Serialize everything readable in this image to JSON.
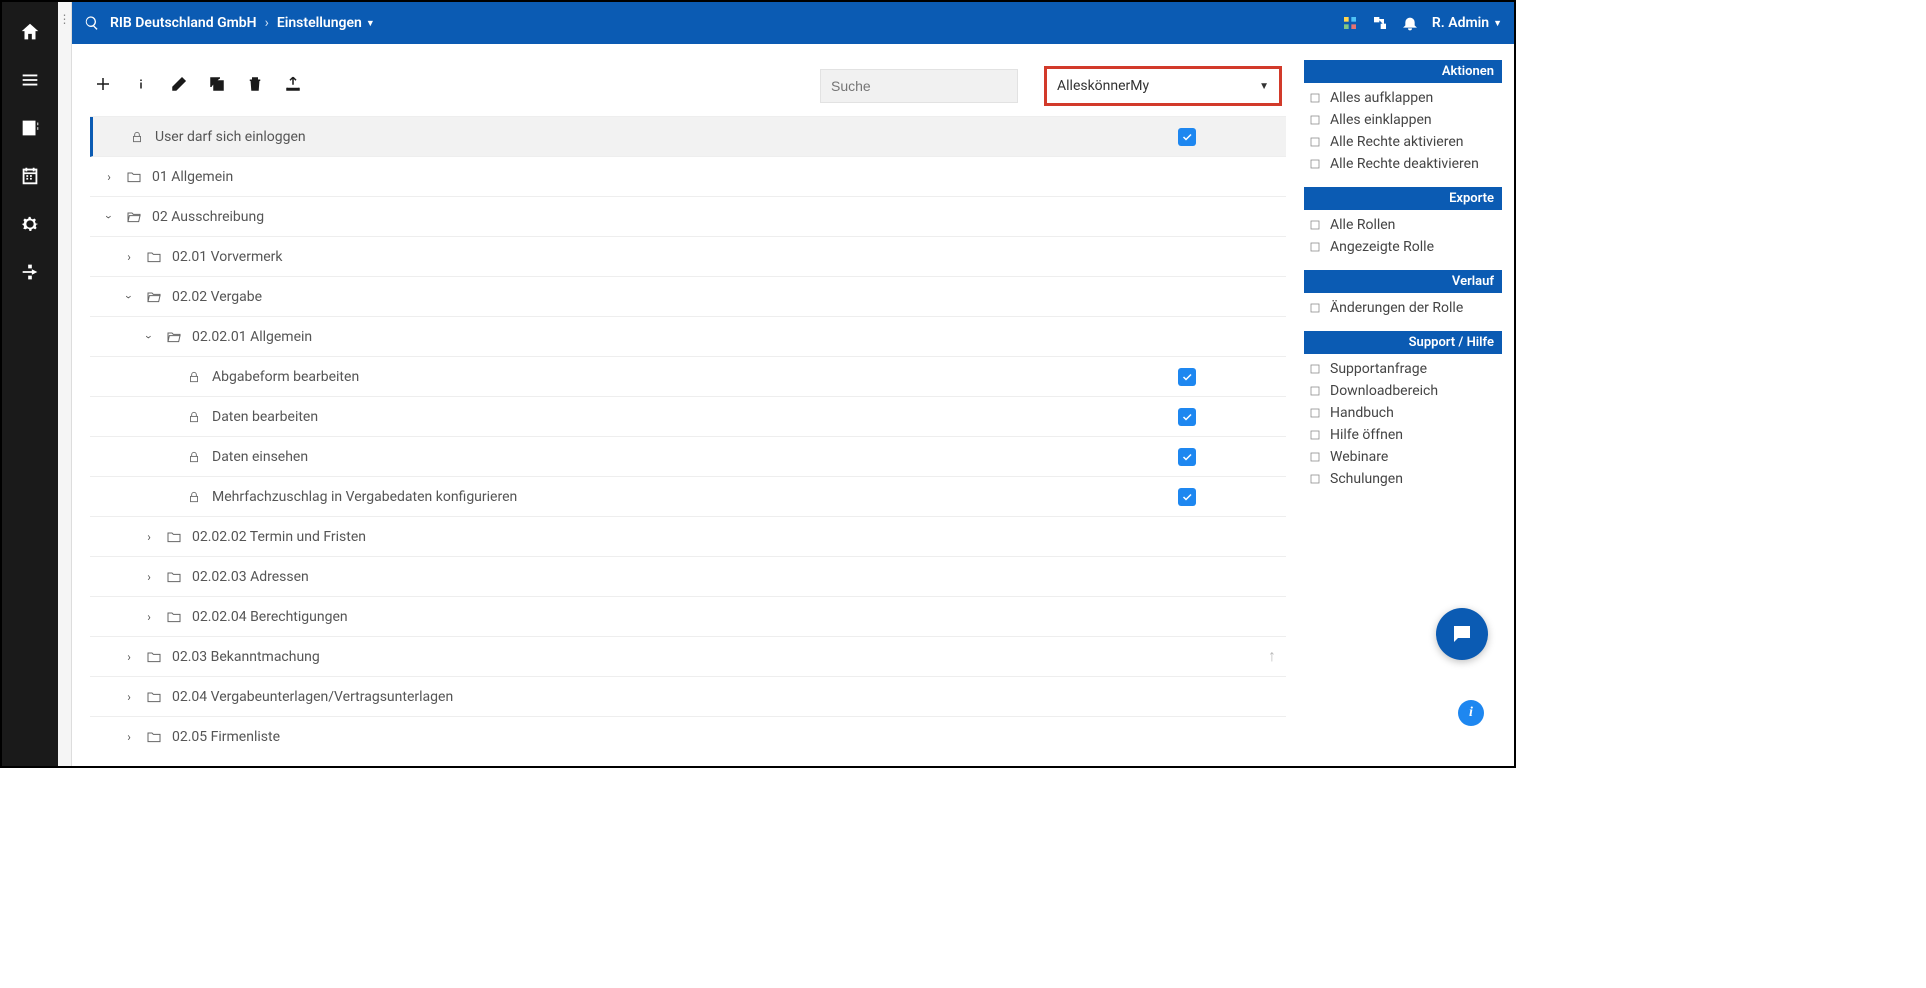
{
  "breadcrumb": {
    "org": "RIB Deutschland GmbH",
    "page": "Einstellungen"
  },
  "user": {
    "name": "R. Admin"
  },
  "search": {
    "placeholder": "Suche"
  },
  "role_dropdown": {
    "selected": "AlleskönnerMy"
  },
  "tree": {
    "login_label": "User darf sich einloggen",
    "n01": "01 Allgemein",
    "n02": "02 Ausschreibung",
    "n0201": "02.01 Vorvermerk",
    "n0202": "02.02 Vergabe",
    "n020201": "02.02.01 Allgemein",
    "leaf_abgabe": "Abgabeform bearbeiten",
    "leaf_bearb": "Daten bearbeiten",
    "leaf_einseh": "Daten einsehen",
    "leaf_mehrfach": "Mehrfachzuschlag in Vergabedaten konfigurieren",
    "n020202": "02.02.02 Termin und Fristen",
    "n020203": "02.02.03 Adressen",
    "n020204": "02.02.04 Berechtigungen",
    "n0203": "02.03 Bekanntmachung",
    "n0204": "02.04 Vergabeunterlagen/Vertragsunterlagen",
    "n0205": "02.05 Firmenliste"
  },
  "panels": {
    "aktionen": {
      "title": "Aktionen",
      "items": [
        "Alles aufklappen",
        "Alles einklappen",
        "Alle Rechte aktivieren",
        "Alle Rechte deaktivieren"
      ]
    },
    "exporte": {
      "title": "Exporte",
      "items": [
        "Alle Rollen",
        "Angezeigte Rolle"
      ]
    },
    "verlauf": {
      "title": "Verlauf",
      "items": [
        "Änderungen der Rolle"
      ]
    },
    "support": {
      "title": "Support / Hilfe",
      "items": [
        "Supportanfrage",
        "Downloadbereich",
        "Handbuch",
        "Hilfe öffnen",
        "Webinare",
        "Schulungen"
      ]
    }
  }
}
